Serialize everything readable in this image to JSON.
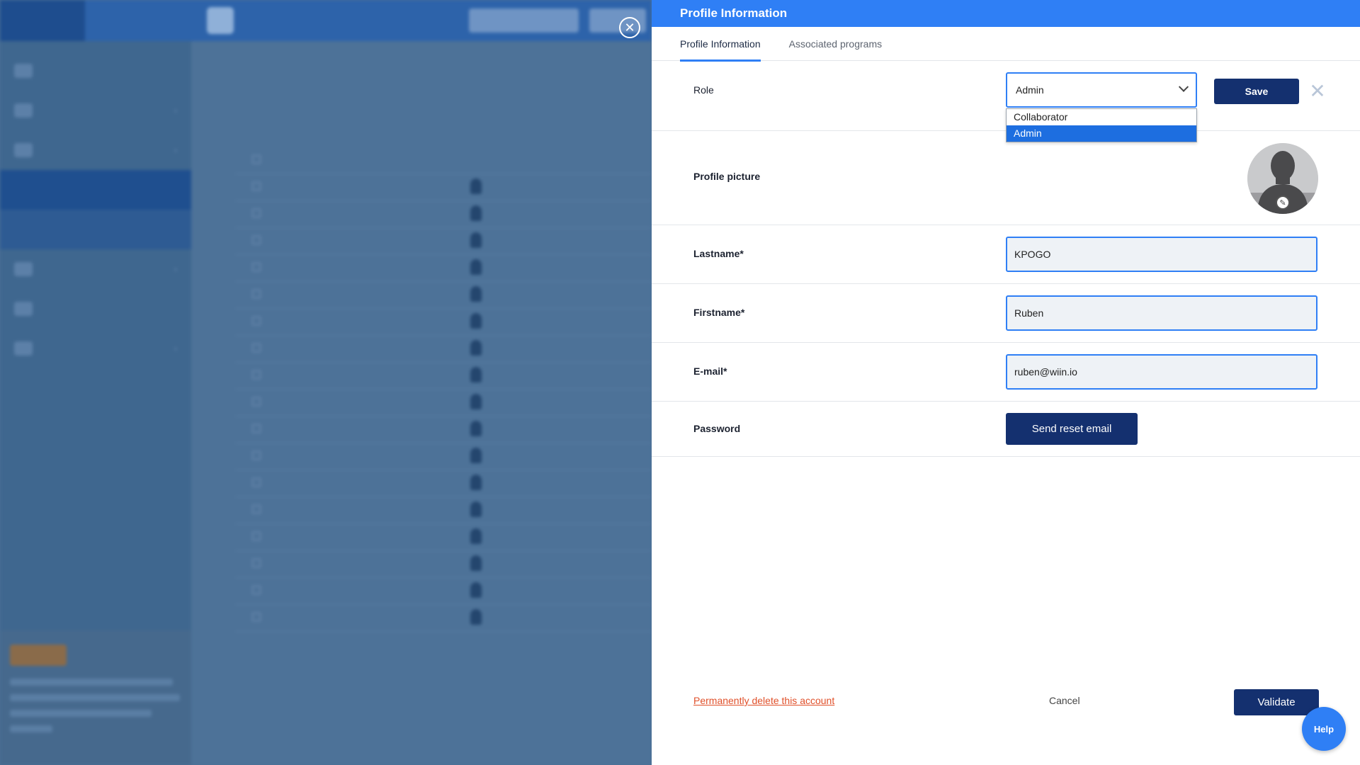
{
  "panel": {
    "title": "Profile Information",
    "tabs": [
      {
        "label": "Profile Information",
        "active": true
      },
      {
        "label": "Associated programs",
        "active": false
      }
    ],
    "role": {
      "label": "Role",
      "value": "Admin",
      "options": [
        "Collaborator",
        "Admin"
      ],
      "selected": "Admin",
      "save_label": "Save",
      "cancel_icon": "close-x-icon"
    },
    "picture": {
      "label": "Profile picture",
      "edit_icon": "pencil-icon"
    },
    "lastname": {
      "label": "Lastname*",
      "value": "KPOGO"
    },
    "firstname": {
      "label": "Firstname*",
      "value": "Ruben"
    },
    "email": {
      "label": "E-mail*",
      "value": "ruben@wiin.io"
    },
    "password": {
      "label": "Password",
      "button_label": "Send reset email"
    },
    "footer": {
      "delete_label": "Permanently delete this account",
      "cancel_label": "Cancel",
      "validate_label": "Validate"
    },
    "help_label": "Help"
  },
  "colors": {
    "accent": "#2f7ff5",
    "primary_button": "#14306f",
    "danger": "#e0502a",
    "overlay": "#4a6f96"
  }
}
